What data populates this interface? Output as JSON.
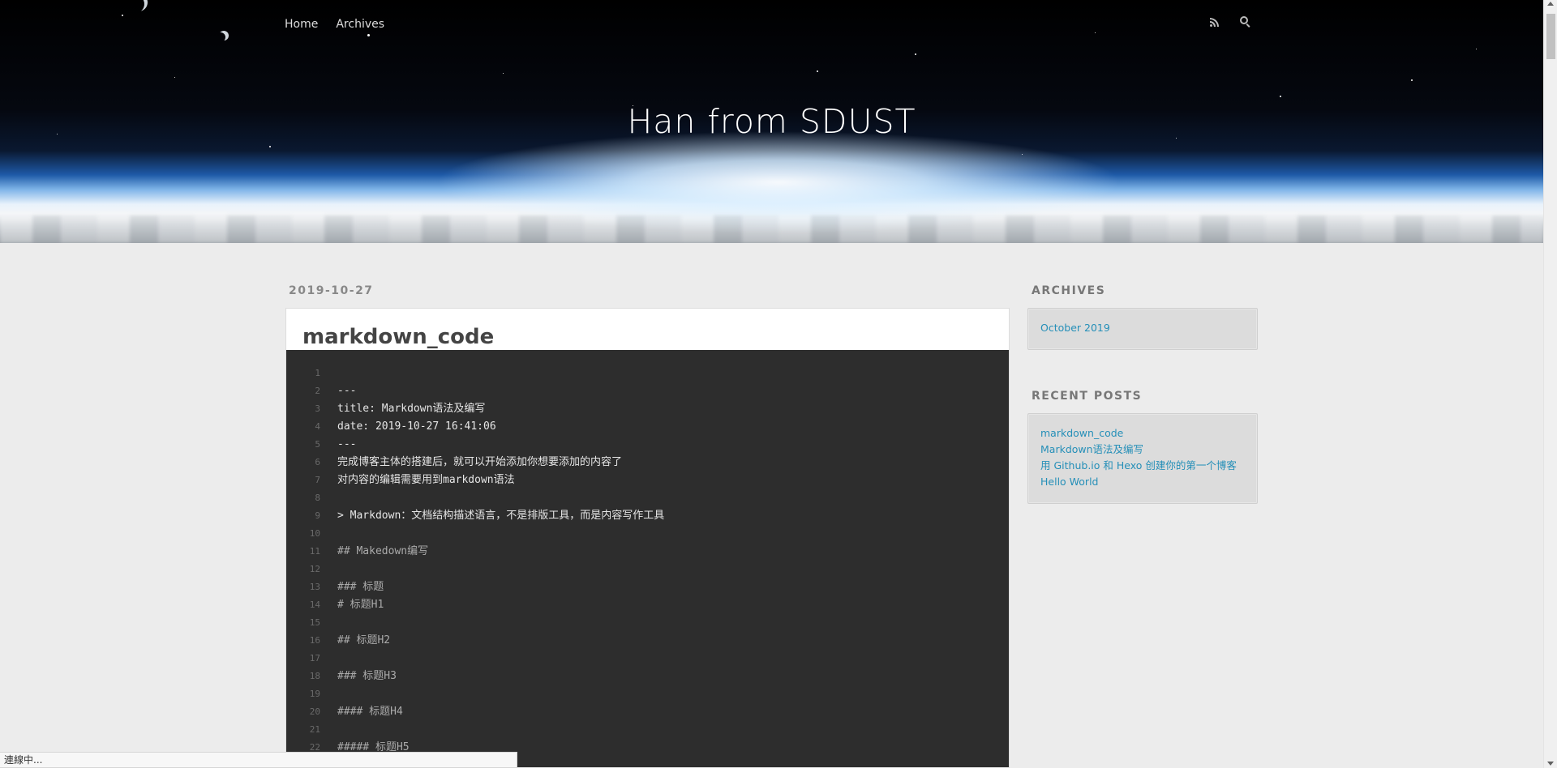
{
  "header": {
    "nav": [
      {
        "label": "Home"
      },
      {
        "label": "Archives"
      }
    ],
    "site_title": "Han from SDUST",
    "icons": [
      "rss-icon",
      "search-icon"
    ]
  },
  "post": {
    "date": "2019-10-27",
    "title": "markdown_code",
    "code_lines": [
      {
        "n": "1",
        "text": ""
      },
      {
        "n": "2",
        "text": "---"
      },
      {
        "n": "3",
        "text": "title: Markdown语法及编写"
      },
      {
        "n": "4",
        "text": "date: 2019-10-27 16:41:06"
      },
      {
        "n": "5",
        "text": "---"
      },
      {
        "n": "6",
        "text": "完成博客主体的搭建后，就可以开始添加你想要添加的内容了"
      },
      {
        "n": "7",
        "text": "对内容的编辑需要用到markdown语法"
      },
      {
        "n": "8",
        "text": ""
      },
      {
        "n": "9",
        "text": "> Markdown：文档结构描述语言，不是排版工具，而是内容写作工具"
      },
      {
        "n": "10",
        "text": ""
      },
      {
        "n": "11",
        "text": "## Makedown编写"
      },
      {
        "n": "12",
        "text": ""
      },
      {
        "n": "13",
        "text": "### 标题"
      },
      {
        "n": "14",
        "text": "# 标题H1"
      },
      {
        "n": "15",
        "text": ""
      },
      {
        "n": "16",
        "text": "## 标题H2"
      },
      {
        "n": "17",
        "text": ""
      },
      {
        "n": "18",
        "text": "### 标题H3"
      },
      {
        "n": "19",
        "text": ""
      },
      {
        "n": "20",
        "text": "#### 标题H4"
      },
      {
        "n": "21",
        "text": ""
      },
      {
        "n": "22",
        "text": "##### 标题H5"
      }
    ]
  },
  "sidebar": {
    "archives_heading": "ARCHIVES",
    "archives": [
      {
        "label": "October 2019"
      }
    ],
    "recent_heading": "RECENT POSTS",
    "recent": [
      {
        "label": "markdown_code"
      },
      {
        "label": "Markdown语法及编写"
      },
      {
        "label": "用 Github.io 和 Hexo 创建你的第一个博客"
      },
      {
        "label": "Hello World"
      }
    ]
  },
  "status_bar": {
    "text": "連線中..."
  },
  "colors": {
    "link": "#258fb8",
    "code_bg": "#2d2d2d",
    "page_bg": "#ececec"
  }
}
